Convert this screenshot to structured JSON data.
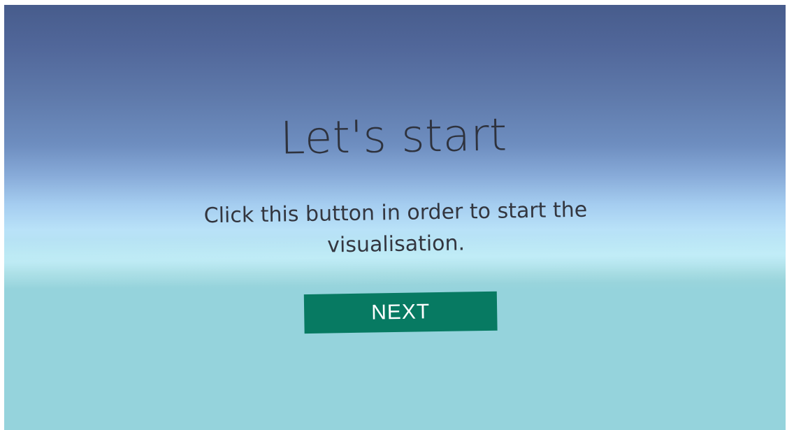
{
  "start_screen": {
    "title": "Let's start",
    "instruction": "Click this button in order to start the visualisation.",
    "next_button_label": "NEXT"
  },
  "colors": {
    "sky_top": "#475c8c",
    "horizon": "#b9e2f8",
    "ground": "#95d3dc",
    "button_bg": "#077a62",
    "button_text": "#ffffff",
    "text": "#2e323d"
  }
}
